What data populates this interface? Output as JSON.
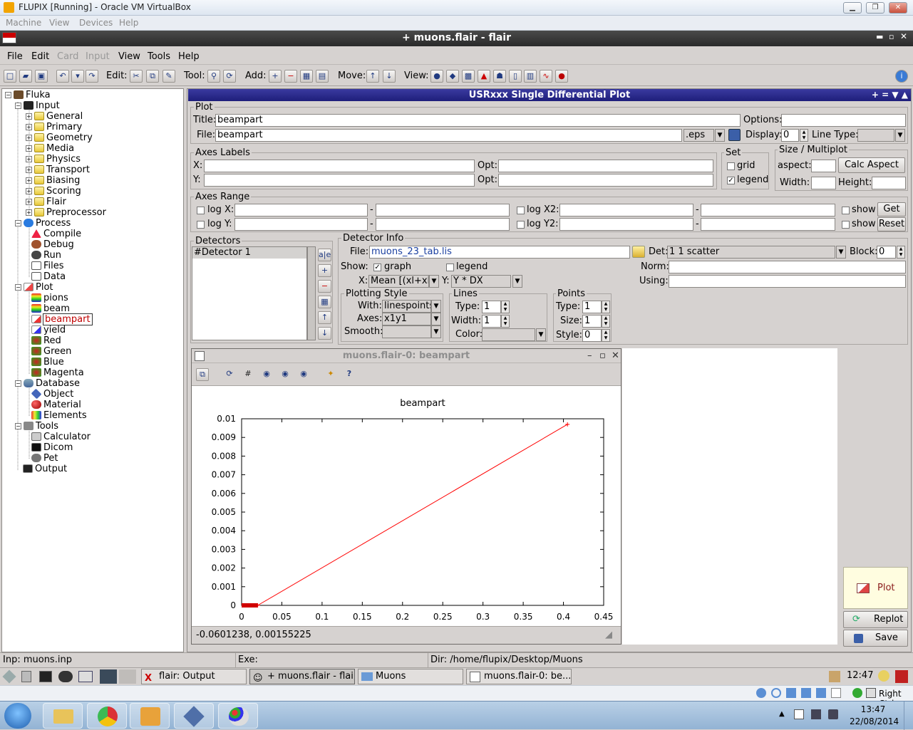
{
  "vbox": {
    "title": "FLUPIX [Running] - Oracle VM VirtualBox",
    "menu": [
      "Machine",
      "View",
      "Devices",
      "Help"
    ],
    "status_host_key": "Right Ctrl"
  },
  "flair": {
    "title": "+ muons.flair - flair"
  },
  "menu": [
    "File",
    "Edit",
    "Card",
    "Input",
    "View",
    "Tools",
    "Help"
  ],
  "toolbar": {
    "edit": "Edit:",
    "tool": "Tool:",
    "add": "Add:",
    "move": "Move:",
    "view": "View:"
  },
  "tree": [
    {
      "label": "Fluka",
      "icon": "fluka-icon"
    },
    {
      "label": "Input",
      "icon": "input-icon"
    },
    {
      "label": "General",
      "icon": "folder-icon"
    },
    {
      "label": "Primary",
      "icon": "folder-icon"
    },
    {
      "label": "Geometry",
      "icon": "folder-icon"
    },
    {
      "label": "Media",
      "icon": "folder-icon"
    },
    {
      "label": "Physics",
      "icon": "folder-icon"
    },
    {
      "label": "Transport",
      "icon": "folder-icon"
    },
    {
      "label": "Biasing",
      "icon": "folder-icon"
    },
    {
      "label": "Scoring",
      "icon": "folder-icon"
    },
    {
      "label": "Flair",
      "icon": "folder-icon"
    },
    {
      "label": "Preprocessor",
      "icon": "folder-icon"
    },
    {
      "label": "Process",
      "icon": "process-icon"
    },
    {
      "label": "Compile",
      "icon": "compile-icon"
    },
    {
      "label": "Debug",
      "icon": "debug-icon"
    },
    {
      "label": "Run",
      "icon": "run-icon"
    },
    {
      "label": "Files",
      "icon": "file-icon"
    },
    {
      "label": "Data",
      "icon": "file-icon"
    },
    {
      "label": "Plot",
      "icon": "plot-icon"
    },
    {
      "label": "pions",
      "icon": "usrbin-icon"
    },
    {
      "label": "beam",
      "icon": "usrbin-icon"
    },
    {
      "label": "beampart",
      "icon": "usrxxx-icon"
    },
    {
      "label": "yield",
      "icon": "yield-icon"
    },
    {
      "label": "Red",
      "icon": "geometry-plot-icon"
    },
    {
      "label": "Green",
      "icon": "geometry-plot-icon"
    },
    {
      "label": "Blue",
      "icon": "geometry-plot-icon"
    },
    {
      "label": "Magenta",
      "icon": "geometry-plot-icon"
    },
    {
      "label": "Database",
      "icon": "database-icon"
    },
    {
      "label": "Object",
      "icon": "object-icon"
    },
    {
      "label": "Material",
      "icon": "material-icon"
    },
    {
      "label": "Elements",
      "icon": "elements-icon"
    },
    {
      "label": "Tools",
      "icon": "tools-icon"
    },
    {
      "label": "Calculator",
      "icon": "calculator-icon"
    },
    {
      "label": "Dicom",
      "icon": "dicom-icon"
    },
    {
      "label": "Pet",
      "icon": "pet-icon"
    },
    {
      "label": "Output",
      "icon": "output-icon"
    }
  ],
  "panel": {
    "title": "USRxxx Single Differential Plot",
    "plot_group": "Plot",
    "title_label": "Title:",
    "title_value": "beampart",
    "options_label": "Options:",
    "options_value": "",
    "file_label": "File:",
    "file_value": "beampart",
    "format": ".eps",
    "display_label": "Display:",
    "display_value": "0",
    "linetype_label": "Line Type:",
    "linetype_value": "",
    "axes_labels_group": "Axes Labels",
    "x_label": "X:",
    "y_label": "Y:",
    "opt_label": "Opt:",
    "set_group": "Set",
    "grid": "grid",
    "legend": "legend",
    "grid_checked": false,
    "legend_checked": true,
    "size_group": "Size / Multiplot",
    "aspect_label": "aspect:",
    "calc_aspect": "Calc Aspect",
    "width_label": "Width:",
    "height_label": "Height:",
    "axes_range_group": "Axes Range",
    "logx": "log X:",
    "logy": "log Y:",
    "logx2": "log X2:",
    "logy2": "log Y2:",
    "dash": "-",
    "show": "show",
    "get": "Get",
    "reset": "Reset",
    "detectors_group": "Detectors",
    "detector_1": "#Detector 1",
    "det_info_group": "Detector Info",
    "det_file_label": "File:",
    "det_file_value": "muons_23_tab.lis",
    "det_label": "Det:",
    "det_value": "1 1  scatter",
    "block_label": "Block:",
    "block_value": "0",
    "show_label": "Show:",
    "graph": "graph",
    "graph_checked": true,
    "det_legend": "legend",
    "det_legend_checked": false,
    "norm_label": "Norm:",
    "using_label": "Using:",
    "x_expr_label": "X:",
    "x_expr": "Mean [(xl+xh",
    "y_expr_label": "Y:",
    "y_expr": "Y * DX",
    "style_group": "Plotting Style",
    "with_label": "With:",
    "with_value": "linespoints",
    "axes_label": "Axes:",
    "axes_value": "x1y1",
    "smooth_label": "Smooth:",
    "smooth_value": "",
    "lines_group": "Lines",
    "line_type_label": "Type:",
    "line_type": "1",
    "line_width_label": "Width:",
    "line_width": "1",
    "color_label": "Color:",
    "points_group": "Points",
    "pt_type_label": "Type:",
    "pt_type": "1",
    "pt_size_label": "Size:",
    "pt_size": "1",
    "pt_style_label": "Style:",
    "pt_style": "0",
    "plot_btn": "Plot",
    "replot_btn": "Replot",
    "save_btn": "Save"
  },
  "plot_window": {
    "title": "muons.flair-0: beampart",
    "coords": "-0.0601238,  0.00155225"
  },
  "chart_data": {
    "type": "line",
    "title": "beampart",
    "xlabel": "",
    "ylabel": "",
    "xlim": [
      0,
      0.45
    ],
    "ylim": [
      0,
      0.01
    ],
    "x_ticks": [
      "0",
      "0.05",
      "0.1",
      "0.15",
      "0.2",
      "0.25",
      "0.3",
      "0.35",
      "0.4",
      "0.45"
    ],
    "y_ticks": [
      "0",
      "0.001",
      "0.002",
      "0.003",
      "0.004",
      "0.005",
      "0.006",
      "0.007",
      "0.008",
      "0.009",
      "0.01"
    ],
    "series": [
      {
        "color": "#ff0000",
        "points": [
          [
            0.02,
            0
          ],
          [
            0.405,
            0.0097
          ]
        ]
      }
    ],
    "grid": false
  },
  "status": {
    "inp": "Inp: muons.inp",
    "exe": "Exe:",
    "dir": "Dir: /home/flupix/Desktop/Muons"
  },
  "taskbar": {
    "tasks": [
      "flair: Output",
      "+ muons.flair - flair",
      "Muons",
      "muons.flair-0: be..."
    ],
    "clock": "12:47"
  },
  "windows": {
    "time": "13:47",
    "date": "22/08/2014"
  }
}
